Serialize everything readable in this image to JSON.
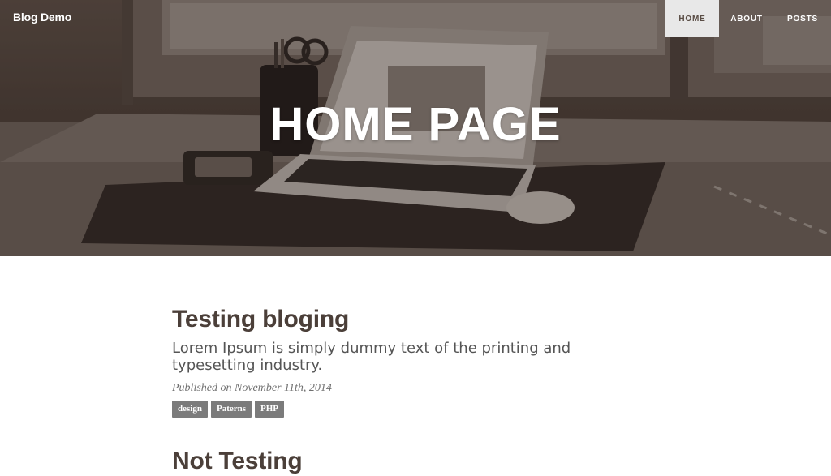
{
  "navbar": {
    "brand": "Blog Demo",
    "items": [
      {
        "label": "HOME",
        "active": true
      },
      {
        "label": "ABOUT",
        "active": false
      },
      {
        "label": "POSTS",
        "active": false
      }
    ]
  },
  "hero": {
    "title": "HOME PAGE"
  },
  "posts": [
    {
      "title": "Testing bloging",
      "subtitle": "Lorem Ipsum is simply dummy text of the printing and typesetting industry.",
      "meta": "Published on November 11th, 2014",
      "tags": [
        "design",
        "Paterns",
        "PHP"
      ]
    },
    {
      "title": "Not Testing"
    }
  ],
  "colors": {
    "hero_bg": "#4a3e37",
    "active_nav_bg": "#e8e8e8",
    "title_text": "#4b3f39",
    "tag_bg": "#7b7b7b"
  }
}
